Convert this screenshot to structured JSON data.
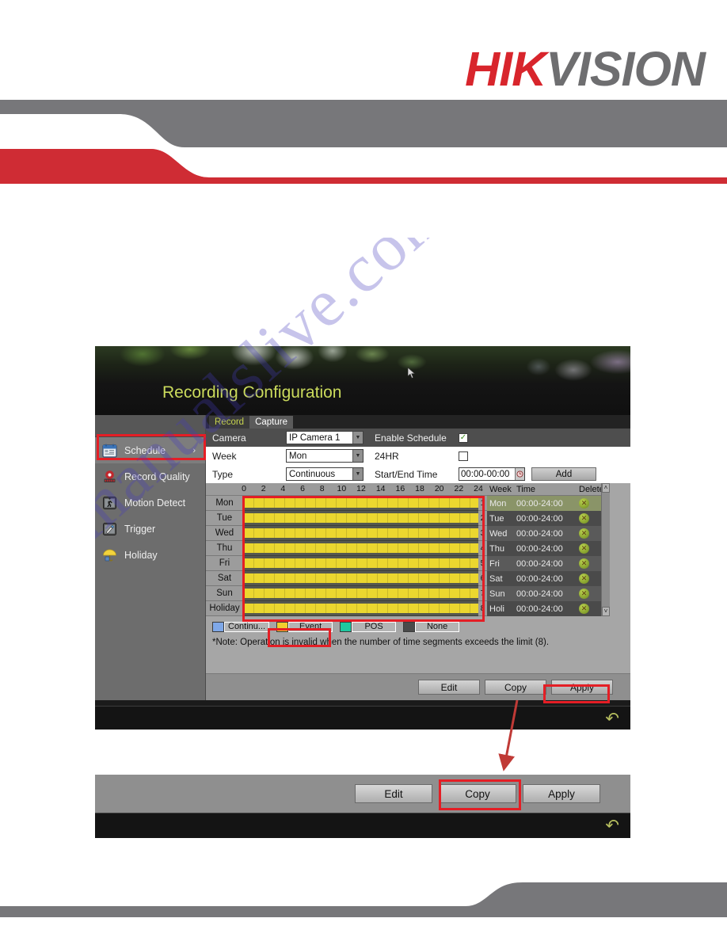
{
  "brand": {
    "part1": "HIK",
    "part2": "VISION",
    "red": "#d8252c",
    "grey": "#6e6e70"
  },
  "watermark": {
    "text": "manualslive.com"
  },
  "screenshot1": {
    "title": "Recording Configuration",
    "tabs": [
      {
        "label": "Record",
        "active": true
      },
      {
        "label": "Capture",
        "active": false
      }
    ],
    "sidebar": [
      {
        "label": "Schedule",
        "icon": "calendar-icon",
        "active": true,
        "chevron": "›"
      },
      {
        "label": "Record Quality",
        "icon": "alarm-icon",
        "active": false
      },
      {
        "label": "Motion Detect",
        "icon": "motion-icon",
        "active": false
      },
      {
        "label": "Trigger",
        "icon": "trigger-icon",
        "active": false
      },
      {
        "label": "Holiday",
        "icon": "umbrella-icon",
        "active": false
      }
    ],
    "form": {
      "camera_label": "Camera",
      "camera_value": "IP Camera 1",
      "enable_schedule_label": "Enable Schedule",
      "enable_schedule_checked": "✓",
      "week_label": "Week",
      "week_value": "Mon",
      "hr24_label": "24HR",
      "type_label": "Type",
      "type_value": "Continuous",
      "start_end_label": "Start/End Time",
      "start_end_value": "00:00-00:00",
      "clock_icon": "◔",
      "add_label": "Add"
    },
    "grid": {
      "hour_ticks": [
        "0",
        "2",
        "4",
        "6",
        "8",
        "10",
        "12",
        "14",
        "16",
        "18",
        "20",
        "22",
        "24"
      ],
      "rows": [
        {
          "day": "Mon",
          "index": "1"
        },
        {
          "day": "Tue",
          "index": "2"
        },
        {
          "day": "Wed",
          "index": "3"
        },
        {
          "day": "Thu",
          "index": "4"
        },
        {
          "day": "Fri",
          "index": "5"
        },
        {
          "day": "Sat",
          "index": "6"
        },
        {
          "day": "Sun",
          "index": "7"
        },
        {
          "day": "Holiday",
          "index": "8"
        }
      ]
    },
    "table": {
      "headers": [
        "Week",
        "Time",
        "Delete"
      ],
      "rows": [
        {
          "week": "Mon",
          "time": "00:00-24:00",
          "delete_icon": "🗑",
          "selected": true
        },
        {
          "week": "Tue",
          "time": "00:00-24:00",
          "delete_icon": "🗑",
          "selected": false
        },
        {
          "week": "Wed",
          "time": "00:00-24:00",
          "delete_icon": "🗑",
          "selected": false
        },
        {
          "week": "Thu",
          "time": "00:00-24:00",
          "delete_icon": "🗑",
          "selected": false
        },
        {
          "week": "Fri",
          "time": "00:00-24:00",
          "delete_icon": "🗑",
          "selected": false
        },
        {
          "week": "Sat",
          "time": "00:00-24:00",
          "delete_icon": "🗑",
          "selected": false
        },
        {
          "week": "Sun",
          "time": "00:00-24:00",
          "delete_icon": "🗑",
          "selected": false
        },
        {
          "week": "Holi",
          "time": "00:00-24:00",
          "delete_icon": "🗑",
          "selected": false
        }
      ],
      "scroll_up": "˄",
      "scroll_down": "˅"
    },
    "legend": [
      {
        "label": "Continu...",
        "color": "#7fa8e8"
      },
      {
        "label": "Event",
        "color": "#f2cd2e"
      },
      {
        "label": "POS",
        "color": "#1ec8a0"
      },
      {
        "label": "None",
        "color": "#4a4a4a"
      }
    ],
    "note": "*Note: Operation is invalid when the number of time segments exceeds the limit (8).",
    "buttons": [
      {
        "label": "Edit"
      },
      {
        "label": "Copy"
      },
      {
        "label": "Apply"
      }
    ],
    "back_icon": "↶"
  },
  "screenshot2": {
    "buttons": [
      {
        "label": "Edit"
      },
      {
        "label": "Copy"
      },
      {
        "label": "Apply"
      }
    ],
    "back_icon": "↶"
  },
  "annotations": {
    "highlight_color": "#e41e25",
    "boxes": [
      "sidebar-schedule",
      "schedule-grid",
      "legend-event",
      "apply-button",
      "copy-button"
    ]
  }
}
